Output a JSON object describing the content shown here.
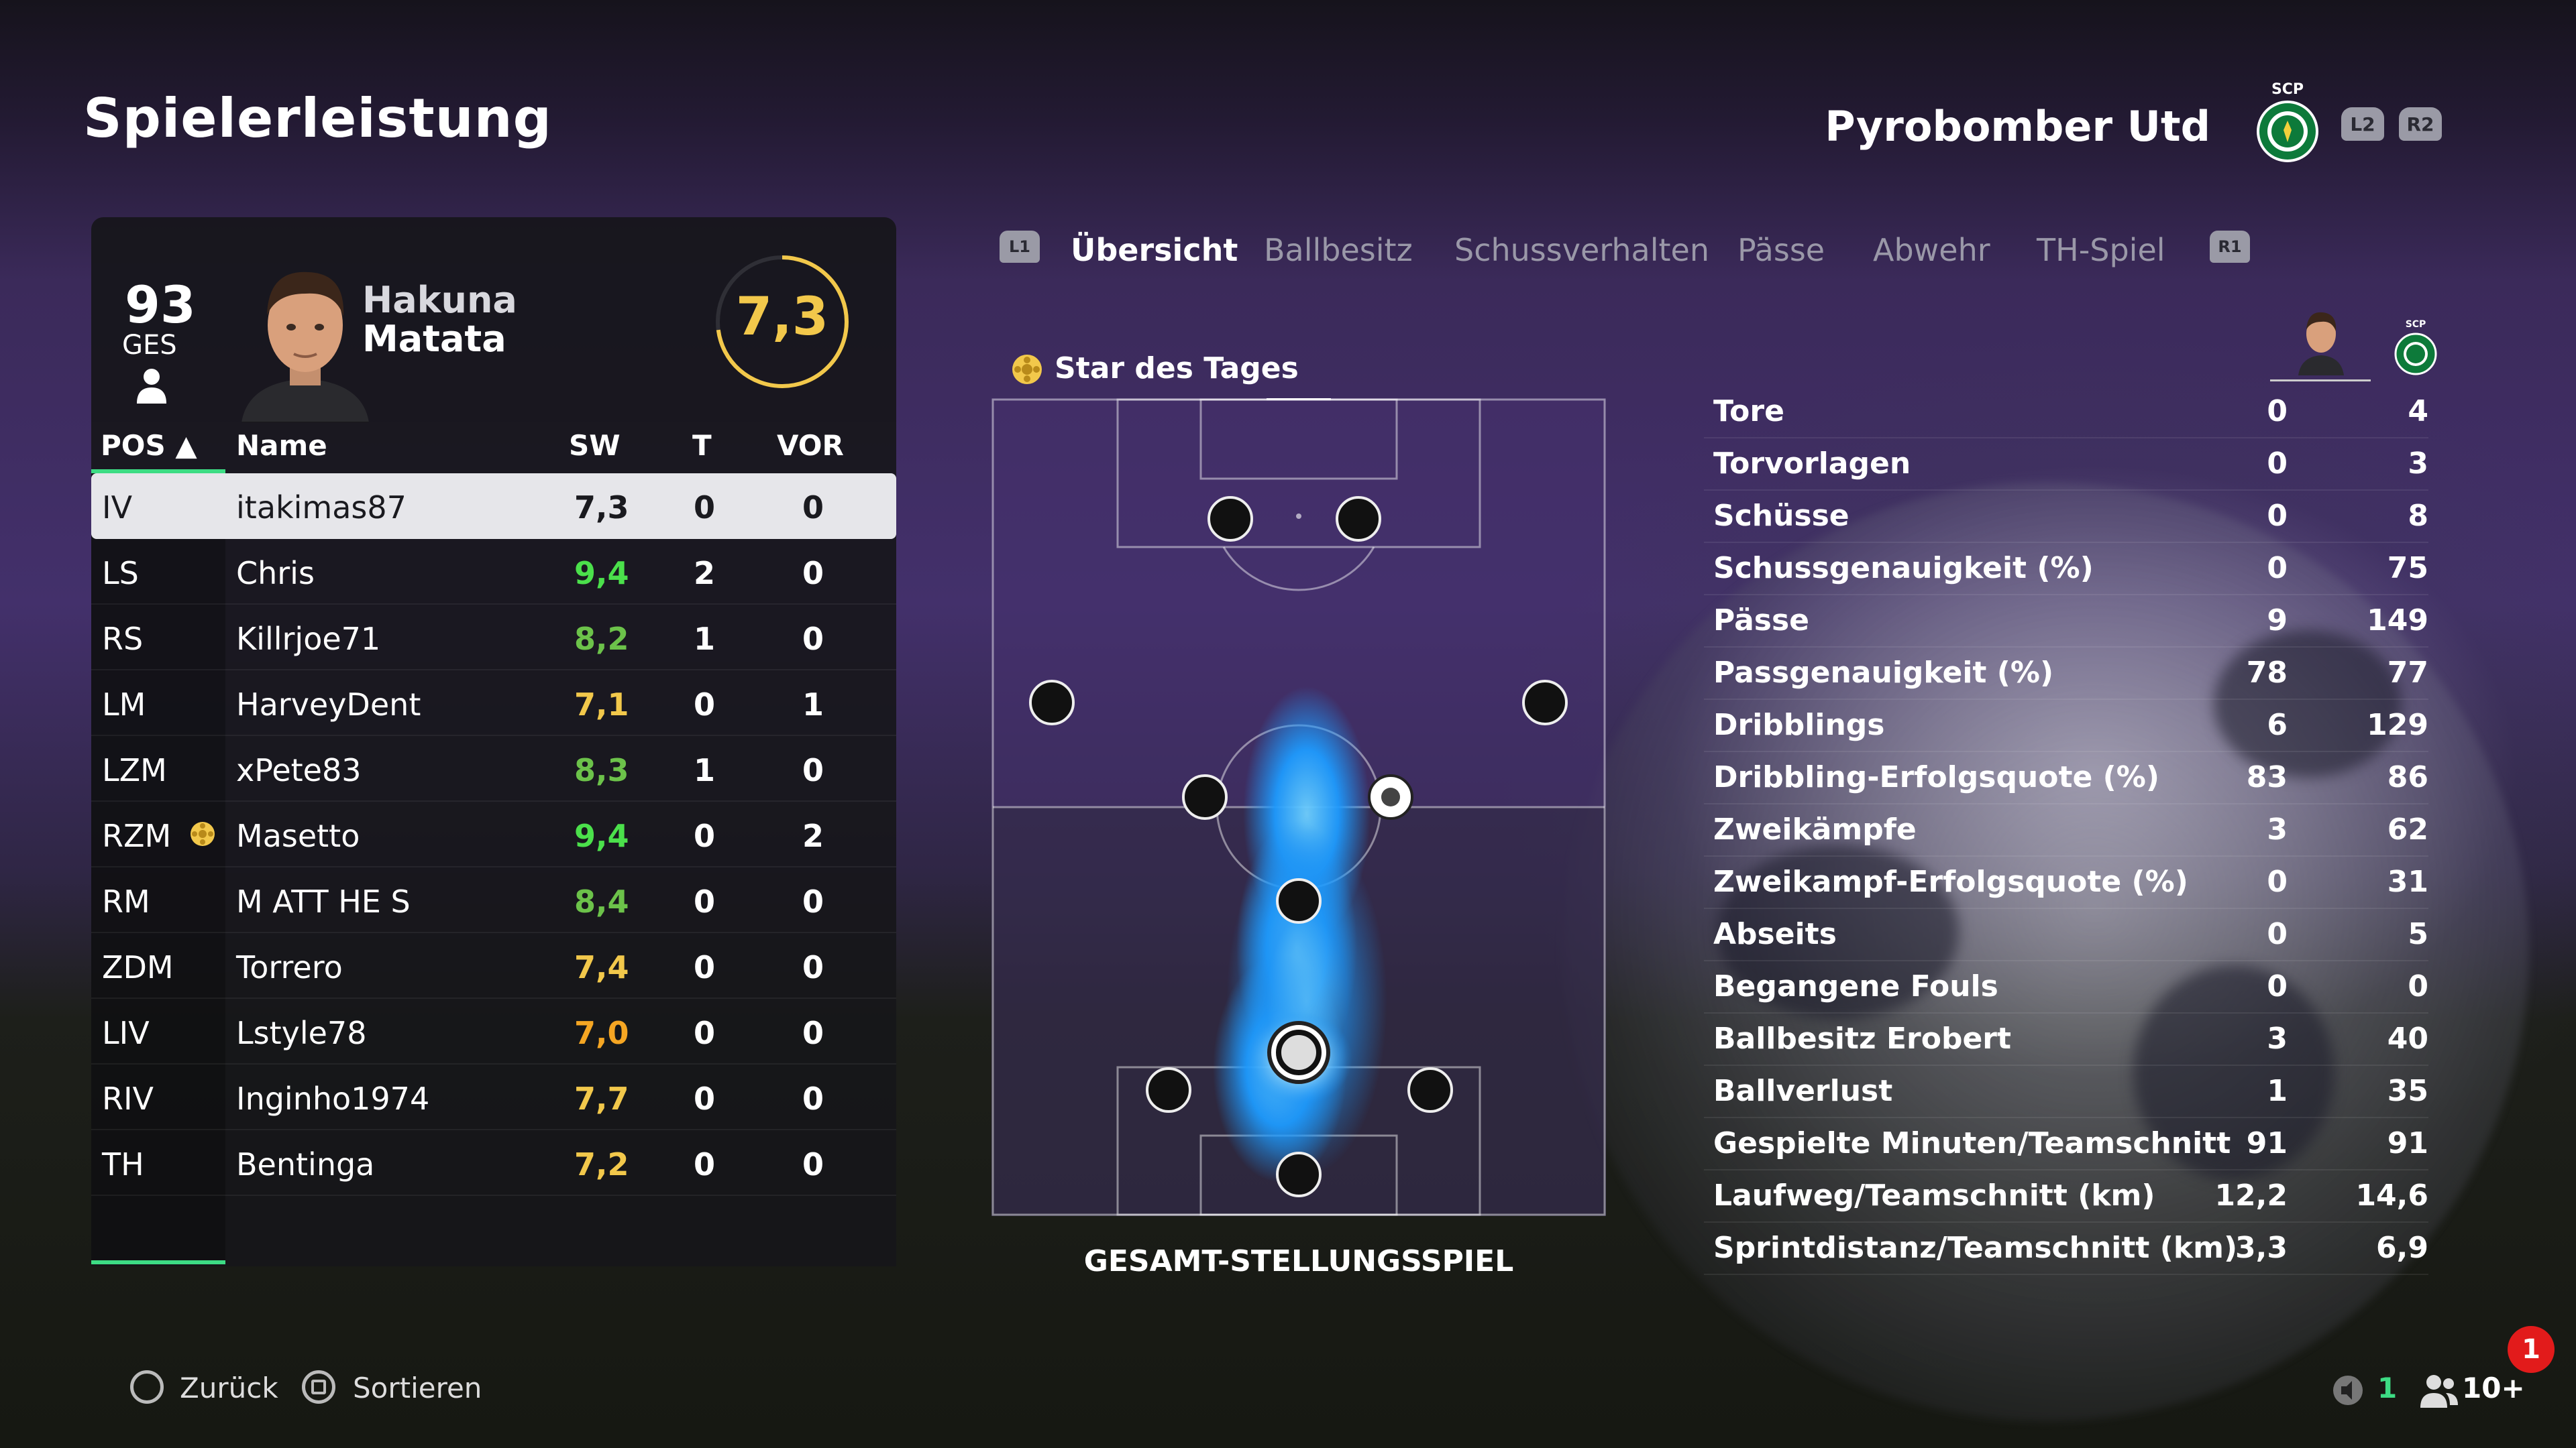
{
  "page_title": "Spielerleistung",
  "team": {
    "name": "Pyrobomber Utd",
    "crest_text": "SCP",
    "shoulder_left": "L2",
    "shoulder_right": "R2"
  },
  "player_card": {
    "overall": "93",
    "overall_label": "GES",
    "first_name": "Hakuna",
    "last_name": "Matata",
    "rating": "7,3"
  },
  "table": {
    "headers": {
      "pos": "POS ▲",
      "name": "Name",
      "sw": "SW",
      "t": "T",
      "vor": "VOR"
    },
    "rows": [
      {
        "pos": "IV",
        "name": "itakimas87",
        "sw": "7,3",
        "t": "0",
        "vor": "0",
        "sw_color": "#1a1a1f"
      },
      {
        "pos": "LS",
        "name": "Chris",
        "sw": "9,4",
        "t": "2",
        "vor": "0",
        "sw_color": "#4be04b"
      },
      {
        "pos": "RS",
        "name": "Killrjoe71",
        "sw": "8,2",
        "t": "1",
        "vor": "0",
        "sw_color": "#6cc24a"
      },
      {
        "pos": "LM",
        "name": "HarveyDent",
        "sw": "7,1",
        "t": "0",
        "vor": "1",
        "sw_color": "#f2c84b"
      },
      {
        "pos": "LZM",
        "name": "xPete83",
        "sw": "8,3",
        "t": "1",
        "vor": "0",
        "sw_color": "#6cc24a"
      },
      {
        "pos": "RZM",
        "name": "Masetto",
        "sw": "9,4",
        "t": "0",
        "vor": "2",
        "sw_color": "#4be04b"
      },
      {
        "pos": "RM",
        "name": "M ATT HE S",
        "sw": "8,4",
        "t": "0",
        "vor": "0",
        "sw_color": "#6cc24a"
      },
      {
        "pos": "ZDM",
        "name": "Torrero",
        "sw": "7,4",
        "t": "0",
        "vor": "0",
        "sw_color": "#f2c84b"
      },
      {
        "pos": "LIV",
        "name": "Lstyle78",
        "sw": "7,0",
        "t": "0",
        "vor": "0",
        "sw_color": "#f5a623"
      },
      {
        "pos": "RIV",
        "name": "Inginho1974",
        "sw": "7,7",
        "t": "0",
        "vor": "0",
        "sw_color": "#f2c84b"
      },
      {
        "pos": "TH",
        "name": "Bentinga",
        "sw": "7,2",
        "t": "0",
        "vor": "0",
        "sw_color": "#f2c84b"
      }
    ]
  },
  "tabs": {
    "left_key": "L1",
    "right_key": "R1",
    "items": [
      "Übersicht",
      "Ballbesitz",
      "Schussverhalten",
      "Pässe",
      "Abwehr",
      "TH-Spiel"
    ],
    "active": "Übersicht"
  },
  "star_of_day": "Star des Tages",
  "pitch_caption": "GESAMT-STELLUNGSSPIEL",
  "stats": [
    {
      "label": "Tore",
      "player": "0",
      "team": "4"
    },
    {
      "label": "Torvorlagen",
      "player": "0",
      "team": "3"
    },
    {
      "label": "Schüsse",
      "player": "0",
      "team": "8"
    },
    {
      "label": "Schussgenauigkeit (%)",
      "player": "0",
      "team": "75"
    },
    {
      "label": "Pässe",
      "player": "9",
      "team": "149"
    },
    {
      "label": "Passgenauigkeit (%)",
      "player": "78",
      "team": "77"
    },
    {
      "label": "Dribblings",
      "player": "6",
      "team": "129"
    },
    {
      "label": "Dribbling-Erfolgsquote (%)",
      "player": "83",
      "team": "86"
    },
    {
      "label": "Zweikämpfe",
      "player": "3",
      "team": "62"
    },
    {
      "label": "Zweikampf-Erfolgsquote (%)",
      "player": "0",
      "team": "31"
    },
    {
      "label": "Abseits",
      "player": "0",
      "team": "5"
    },
    {
      "label": "Begangene Fouls",
      "player": "0",
      "team": "0"
    },
    {
      "label": "Ballbesitz Erobert",
      "player": "3",
      "team": "40"
    },
    {
      "label": "Ballverlust",
      "player": "1",
      "team": "35"
    },
    {
      "label": "Gespielte Minuten/Teamschnitt",
      "player": "91",
      "team": "91"
    },
    {
      "label": "Laufweg/Teamschnitt (km)",
      "player": "12,2",
      "team": "14,6"
    },
    {
      "label": "Sprintdistanz/Teamschnitt (km)",
      "player": "3,3",
      "team": "6,9"
    }
  ],
  "footer": {
    "back": "Zurück",
    "sort": "Sortieren",
    "voice_count": "1",
    "party_count": "10+",
    "notification_count": "1"
  },
  "colors": {
    "accent_green": "#3ddc84",
    "rating_yellow": "#f2c84b",
    "heatmap_blue": "#1e9bff"
  }
}
